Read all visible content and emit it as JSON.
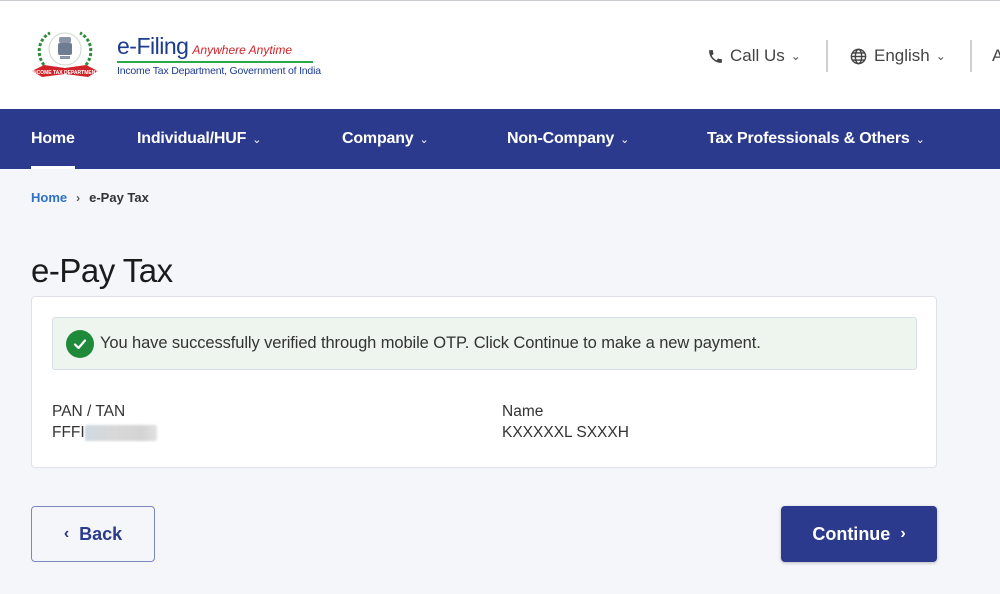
{
  "header": {
    "brand_title": "e-Filing",
    "brand_tagline": "Anywhere Anytime",
    "brand_subtitle": "Income Tax Department, Government of India",
    "logo_ribbon": "INCOME TAX DEPARTMENT",
    "call_us": "Call Us",
    "language": "English",
    "cut_off_item": "A"
  },
  "nav": {
    "items": [
      {
        "label": "Home",
        "active": true
      },
      {
        "label": "Individual/HUF",
        "dropdown": true
      },
      {
        "label": "Company",
        "dropdown": true
      },
      {
        "label": "Non-Company",
        "dropdown": true
      },
      {
        "label": "Tax Professionals & Others",
        "dropdown": true
      }
    ]
  },
  "breadcrumb": {
    "home": "Home",
    "separator": "›",
    "current": "e-Pay Tax"
  },
  "page": {
    "title": "e-Pay Tax",
    "alert": {
      "type": "success",
      "message": "You have successfully verified through mobile OTP. Click Continue to make a new payment."
    },
    "fields": [
      {
        "label": "PAN / TAN",
        "value": "FFFI",
        "masked": true
      },
      {
        "label": "Name",
        "value": "KXXXXXL SXXXH"
      }
    ]
  },
  "actions": {
    "back": "Back",
    "continue": "Continue"
  },
  "colors": {
    "primary": "#2b3a8c",
    "success": "#1f8a3a",
    "link": "#2f72c4",
    "alert_bg": "#edf5ee"
  }
}
